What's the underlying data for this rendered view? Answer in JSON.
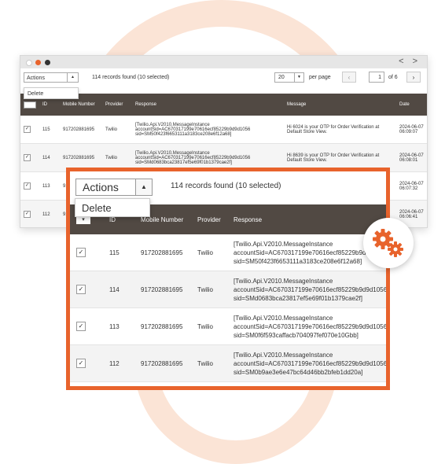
{
  "colors": {
    "accent": "#e8632c",
    "header_bg": "#514943",
    "dot_red": "#e8632c",
    "dot_dark": "#333333",
    "dot_gray": "#ffffff"
  },
  "window": {
    "nav_arrows": "< >"
  },
  "toolbar": {
    "actions_label": "Actions",
    "records_text": "114 records found (10 selected)",
    "per_page_value": "20",
    "per_page_label": "per page",
    "page_value": "1",
    "page_of": "of 6",
    "prev_icon": "chevron-left-icon",
    "next_icon": "chevron-right-icon"
  },
  "dropdown": {
    "delete_label": "Delete"
  },
  "table": {
    "columns": [
      "ID",
      "Mobile Number",
      "Provider",
      "Response",
      "Message",
      "Date"
    ],
    "rows": [
      {
        "id": "115",
        "mobile": "917202881695",
        "provider": "Twilio",
        "response": "[Twilio.Api.V2010.MessageInstance accountSid=AC670317199e70616ecf85229b9d9d1056 sid=SM50f423f6653111a3183ce208e6f12a68]",
        "message": "Hi 6024 is your OTP for Order Verification at Default Store View.",
        "date": "2024-06-07 06:09:07"
      },
      {
        "id": "114",
        "mobile": "917202881695",
        "provider": "Twilio",
        "response": "[Twilio.Api.V2010.MessageInstance accountSid=AC670317199e70616ecf85229b9d9d1056 sid=SMd0683bca23817ef5e69f01b1379cae2f]",
        "message": "Hi 8639 is your OTP for Order Verification at Default Store View.",
        "date": "2024-06-07 06:08:01"
      },
      {
        "id": "113",
        "mobile": "917202881695",
        "provider": "Twilio",
        "response": "[Twilio.Api.V2010.MessageInstance accountSid=AC670317199e70616ecf85229b9d9d1056 sid=SM0f6f593caffacb704097fef070e10Gbb]",
        "message": "",
        "date": "2024-06-07 06:07:32"
      },
      {
        "id": "112",
        "mobile": "917202881695",
        "provider": "Twilio",
        "response": "[Twilio.Api.V2010.MessageInstance accountSid=AC670317199e70616ecf85229b9d9d1056 sid=SM0b9ae3e6e47bc64d46bb2bfeb1dd20a]",
        "message": "",
        "date": "2024-06-07 06:06:41"
      }
    ]
  },
  "badge": {
    "icon": "gears-icon"
  }
}
